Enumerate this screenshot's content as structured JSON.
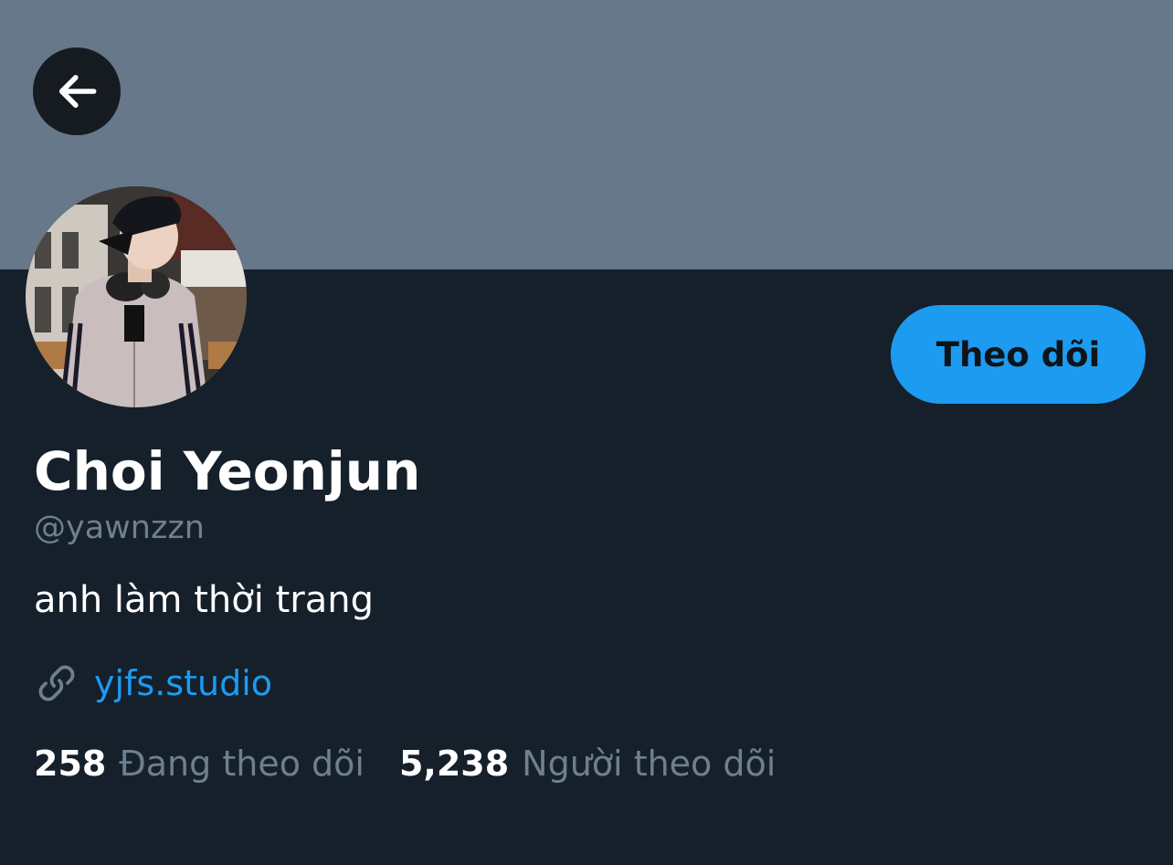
{
  "profile": {
    "display_name": "Choi Yeonjun",
    "handle": "@yawnzzn",
    "bio": "anh làm thời trang",
    "link": "yjfs.studio",
    "follow_label": "Theo dõi",
    "following_count": "258",
    "following_label": "Đang theo dõi",
    "followers_count": "5,238",
    "followers_label": "Người theo dõi"
  },
  "icons": {
    "back": "arrow-left-icon",
    "link": "link-icon"
  },
  "colors": {
    "banner": "#66788a",
    "background": "#15202b",
    "accent": "#1d9bf0",
    "muted_text": "#6e7f8f",
    "back_button": "#151b21"
  }
}
